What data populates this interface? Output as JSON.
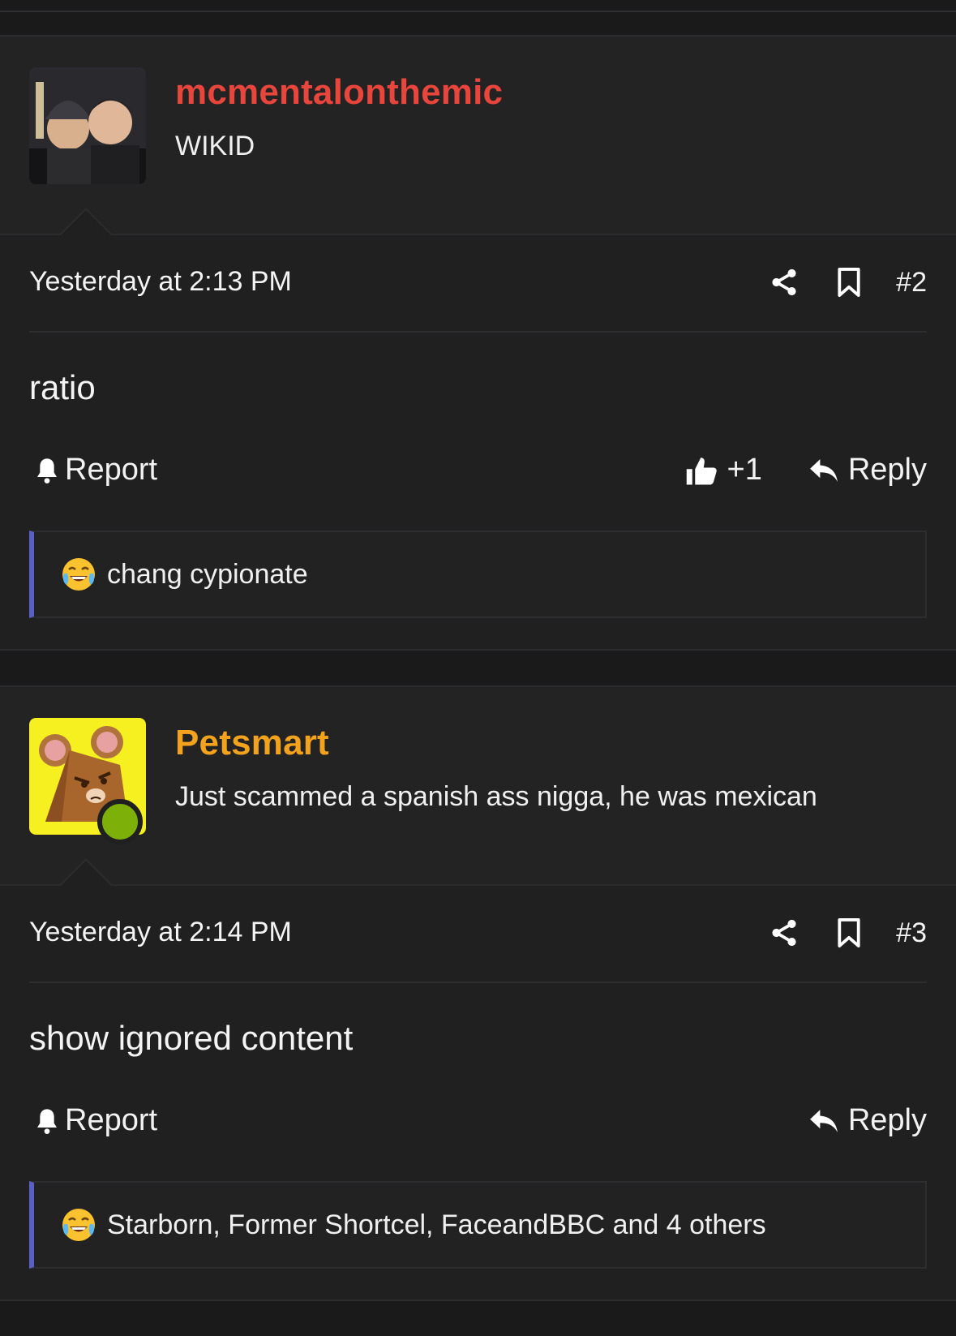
{
  "posts": [
    {
      "username": "mcmentalonthemic",
      "username_color": "#e8453c",
      "user_title": "WIKID",
      "online": false,
      "date": "Yesterday at 2:13 PM",
      "post_number": "#2",
      "content": "ratio",
      "report_label": "Report",
      "like_label": "+1",
      "reply_label": "Reply",
      "reactions_text": "chang cypionate"
    },
    {
      "username": "Petsmart",
      "username_color": "#f3a21d",
      "user_title": "Just scammed a spanish ass nigga, he was mexican",
      "online": true,
      "date": "Yesterday at 2:14 PM",
      "post_number": "#3",
      "content": "show ignored content",
      "report_label": "Report",
      "reply_label": "Reply",
      "reactions_text": "Starborn, Former Shortcel, FaceandBBC and 4 others"
    }
  ],
  "icons": [
    "share-icon",
    "bookmark-icon",
    "bell-icon",
    "thumbs-up-icon",
    "reply-arrow-icon",
    "crying-laughing-emoji"
  ],
  "colors": {
    "background": "#1a1a1b",
    "reaction_bar_accent": "#5a5fc6",
    "online": "#7db10a"
  }
}
